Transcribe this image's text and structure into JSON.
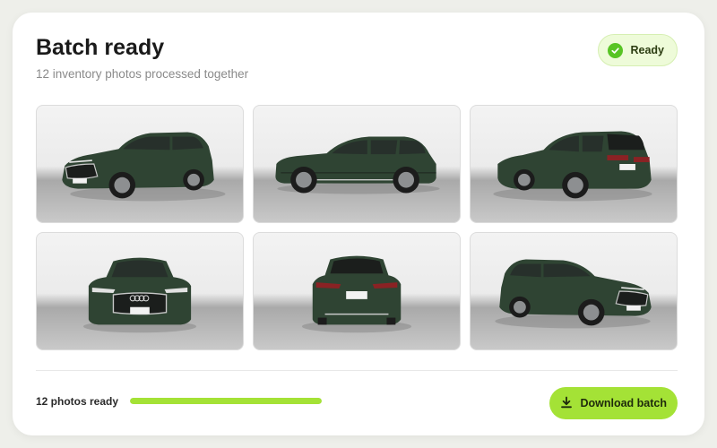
{
  "header": {
    "title": "Batch ready",
    "subtitle": "12 inventory photos processed together"
  },
  "status_badge": {
    "label": "Ready",
    "icon": "check-circle-icon",
    "color": "#58c424"
  },
  "gallery": {
    "photos": [
      {
        "view": "front-left three-quarter"
      },
      {
        "view": "left side profile"
      },
      {
        "view": "rear-left three-quarter"
      },
      {
        "view": "front"
      },
      {
        "view": "rear"
      },
      {
        "view": "front-right three-quarter"
      }
    ]
  },
  "footer": {
    "progress_label": "12 photos ready",
    "progress_percent": 100,
    "download_label": "Download batch",
    "download_icon": "download-icon"
  },
  "colors": {
    "accent": "#a4e236",
    "car_body": "#2f4433",
    "background": "#eeefea"
  }
}
